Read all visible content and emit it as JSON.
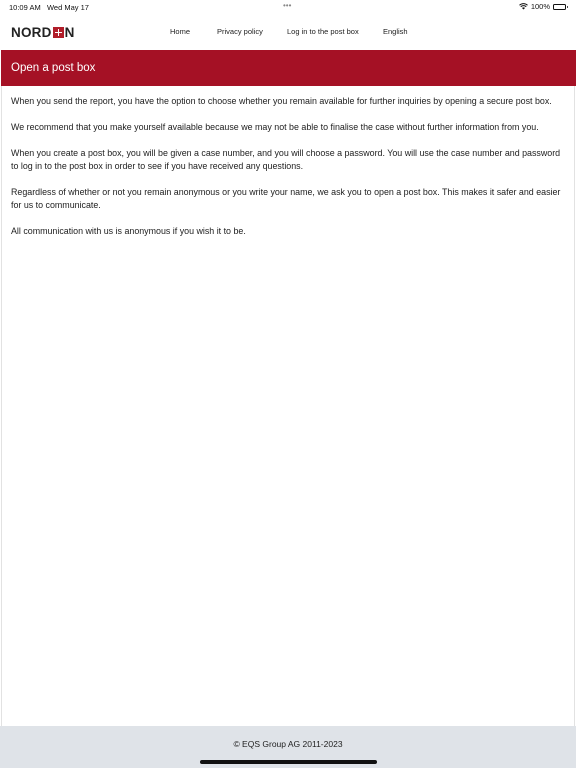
{
  "status_bar": {
    "time": "10:09 AM",
    "date": "Wed May 17",
    "dots": "•••",
    "battery_percent": "100%",
    "wifi_icon": "wifi-icon",
    "battery_icon": "battery-icon"
  },
  "header": {
    "logo_left": "NORD",
    "logo_right": "N",
    "nav": [
      {
        "label": "Home"
      },
      {
        "label": "Privacy policy"
      },
      {
        "label": "Log in to the post box"
      },
      {
        "label": "English"
      }
    ]
  },
  "main": {
    "title": "Open a post box",
    "paragraphs": [
      "When you send the report, you have the option to choose whether you remain available for further inquiries by opening a secure post box.",
      "We recommend that you make yourself available because we may not be able to finalise the case without further information from you.",
      "When you create a post box, you will be given a case number, and you will choose a password. You will use the case number and password to log in to the post box in order to see if you have received any questions.",
      "Regardless of whether or not you remain anonymous or you write your name, we ask you to open a post box. This makes it safer and easier for us to communicate.",
      "All communication with us is anonymous if you wish it to be."
    ]
  },
  "footer": {
    "copyright": "© EQS Group AG 2011-2023"
  },
  "colors": {
    "brand_red": "#a51125",
    "footer_bg": "#dfe3e8"
  }
}
